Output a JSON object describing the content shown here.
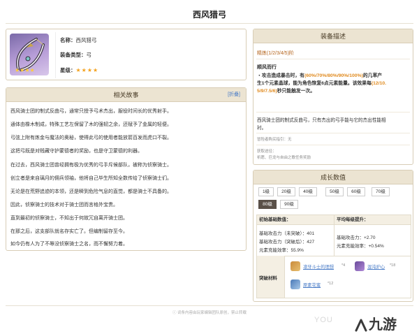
{
  "title": "西风猎弓",
  "card": {
    "name_label": "名称：",
    "name_value": "西风猎弓",
    "type_label": "装备类型：",
    "type_value": "弓",
    "rarity_label": "星级：",
    "rarity_stars": "★★★★",
    "portrait_stars": "★★★★"
  },
  "story": {
    "header": "相关故事",
    "fold": "[折叠]",
    "lines": [
      "西风骑士团的制式反曲弓，通常只授予弓术杰出，服役时间长的优秀射手。",
      "通体由橡木制成，特殊工艺左保留了木的强韧之余，还赋予了金属的轻便。",
      "弓弦上附有炼金与魔法的奥秘，使得此弓的使用者能放箭百发而虎口不裂。",
      "这把弓既是对贱藏守护蒙德者的奖励，也是守卫蒙德的利器。",
      "在过去，西风骑士团曾经拥有极为优秀的弓手斥候部队，被称为侦察骑士。",
      "创立者是来自璃月的佣兵领袖，他将自己毕生所知全数传给了侦察骑士们。",
      "无论是在荒野追迹的本领，还是瞬到危险气息的直觉，都是骑士不具备的。",
      "因此，侦察骑士的技术对于骑士团而言格外宝贵。",
      "直到最初的侦察骑士，不知出于何故冗自离开骑士团。",
      "在那之后，这支部队就名存实亡了。但编制留存至今。",
      "如今仍有人为了不辱没侦察骑士之名，而不懈努力着。"
    ]
  },
  "desc": {
    "header": "装备描述",
    "refine": "精炼(1/2/3/4/5)阶",
    "skill_name": "顺风而行",
    "skill_l1_a": "・攻击造成暴击时，有",
    "skill_l1_b": "(60%/70%/80%/90%/100%)",
    "skill_l1_c": "的几率产",
    "skill_l2_a": "生1个元素晶球，能为角色恢复6点元素能量。该效果每",
    "skill_l2_b": "(12/10.",
    "skill_l3_a": "5/9/7.5/6)",
    "skill_l3_b": "秒只能触发一次。",
    "flavor_1": "西风骑士团的制式反曲弓，只有杰出的弓手能与它的杰出性能相",
    "flavor_2": "衬。",
    "ref_label": "冒险者购买指引：无",
    "source_1": "获取途径：",
    "source_2": "祈愿、巨龙与自由之歌任务奖励"
  },
  "stats": {
    "header": "成长数值",
    "levels": [
      "1级",
      "20级",
      "40级",
      "50级",
      "60级",
      "70级",
      "80级",
      "90级"
    ],
    "selected": "80级",
    "col1_head": "初始基础数值：",
    "col2_head": "平均每级提升：",
    "base_atk": "基础攻击力（未突破）：401",
    "base_atk2": "基础攻击力（突破后）：427",
    "energy": "元素充能效率：55.9%",
    "avg_atk": "基础攻击力：+2.70",
    "avg_energy": "元素充能效率：+0.54%",
    "mat_label": "突破材料",
    "materials": [
      {
        "name": "凛牙斗士的理想",
        "count": "*4"
      },
      {
        "name": "混沌炉心",
        "count": "*18"
      },
      {
        "name": "原素花蜜",
        "count": "*12"
      }
    ]
  },
  "footer": "词条内容由玩家编辑团队原创，禁止转载",
  "watermark": "YOU",
  "logo": "九游",
  "colors": {
    "accent": "#e08a1e",
    "panel_head": "#ece4d2",
    "star": "#f4a21e",
    "link": "#4a7cc7"
  }
}
